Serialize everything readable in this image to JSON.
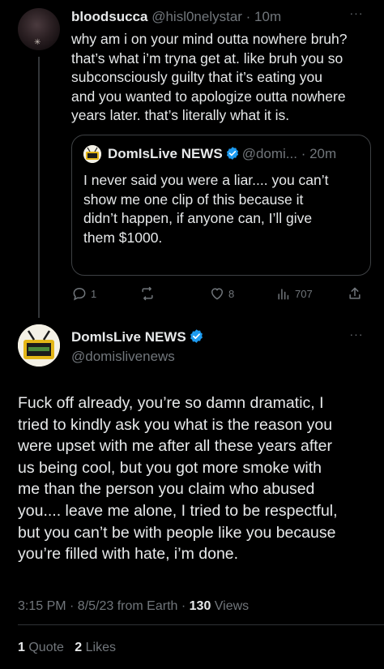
{
  "reply": {
    "display_name": "bloodsucca",
    "handle_time": "@hisl0nelystar · 10m",
    "more_icon": "ellipsis-icon",
    "body_lines": [
      "why am i on your mind outta nowhere bruh?",
      "that’s what i’m tryna get at. like bruh you so",
      "subconsciously guilty that it’s eating you",
      "and you wanted to apologize outta nowhere",
      "years later. that’s literally what it is."
    ],
    "quote": {
      "display_name": "DomIsLive NEWS",
      "handle_time": "@domi... · 20m",
      "body_lines": [
        "I never said you were a liar.... you can’t",
        "show me one clip of this because it",
        "didn’t happen, if anyone can, I’ll give",
        "them $1000."
      ]
    },
    "actions": {
      "replies": "1",
      "reposts": "",
      "likes": "8",
      "views": "707"
    }
  },
  "main": {
    "display_name": "DomIsLive NEWS",
    "handle": "@domislivenews",
    "body_lines": [
      "Fuck off already, you’re so damn dramatic, I",
      "tried to kindly ask you what is the reason you",
      "were upset with me after all these years after",
      "us being cool, but you got more smoke with",
      "me than the person you claim who abused",
      "you.... leave me alone, I tried to be respectful,",
      "but you can’t be with people like you because",
      "you’re filled with hate, i’m done."
    ],
    "meta_prefix": "3:15 PM · 8/5/23 from Earth · ",
    "views_count": "130",
    "views_label": " Views",
    "quotes_count": "1",
    "quotes_label": " Quote",
    "likes_count": "2",
    "likes_label": " Likes"
  },
  "colors": {
    "background": "#000000",
    "text": "#e7e9ea",
    "muted": "#71767b",
    "verified": "#1d9bf0"
  }
}
